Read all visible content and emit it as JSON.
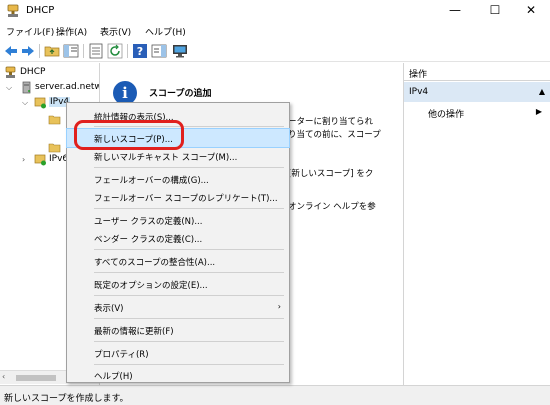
{
  "window": {
    "title": "DHCP",
    "minimize": "—",
    "maximize": "☐",
    "close": "✕"
  },
  "menu": [
    {
      "label": "ファイル(F)"
    },
    {
      "label": "操作(A)"
    },
    {
      "label": "表示(V)"
    },
    {
      "label": "ヘルプ(H)"
    }
  ],
  "tree": {
    "root": "DHCP",
    "server": "server.ad.netw",
    "ipv4": "IPv4",
    "ipv6": "IPv6"
  },
  "center": {
    "title": "スコープの追加",
    "frag1": "ーターに割り当てられ",
    "frag2": "り当ての前に、スコープ",
    "frag3": "[新しいスコープ] をク",
    "frag4": "オンライン ヘルプを参"
  },
  "actions": {
    "header": "操作",
    "section": "IPv4",
    "collapse": "▲",
    "other": "他の操作",
    "other_arrow": "▶"
  },
  "context_menu": {
    "items": [
      {
        "label": "統計情報の表示(S)..."
      },
      {
        "label": "新しいスコープ(P)..."
      },
      {
        "label": "新しいマルチキャスト スコープ(M)..."
      },
      {
        "label": "フェールオーバーの構成(G)..."
      },
      {
        "label": "フェールオーバー スコープのレプリケート(T)..."
      },
      {
        "label": "ユーザー クラスの定義(N)..."
      },
      {
        "label": "ベンダー クラスの定義(C)..."
      },
      {
        "label": "すべてのスコープの整合性(A)..."
      },
      {
        "label": "既定のオプションの設定(E)..."
      },
      {
        "label": "表示(V)",
        "arrow": "›"
      },
      {
        "label": "最新の情報に更新(F)"
      },
      {
        "label": "プロパティ(R)"
      },
      {
        "label": "ヘルプ(H)"
      }
    ],
    "highlighted_index": 1
  },
  "status": {
    "text": "新しいスコープを作成します。"
  },
  "colors": {
    "highlight": "#cde8ff",
    "annotation_ring": "#e0201e",
    "actions_section": "#dbe8f5",
    "info_icon": "#1b5bb5"
  }
}
